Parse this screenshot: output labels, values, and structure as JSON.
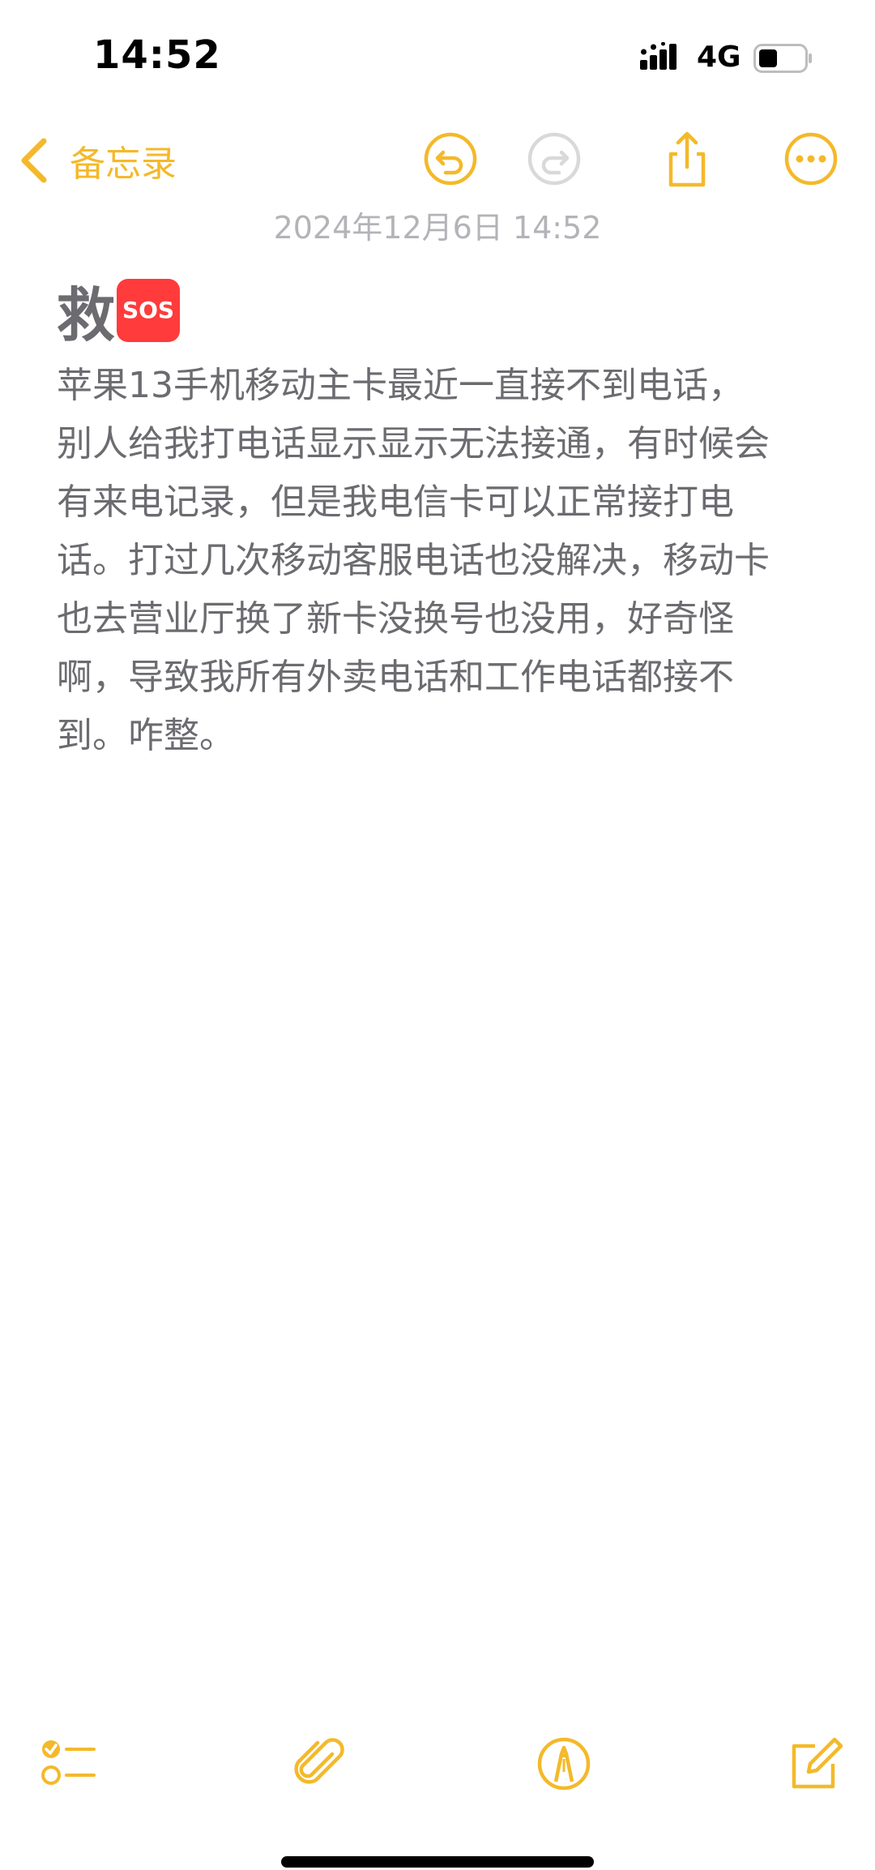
{
  "status_bar": {
    "time": "14:52",
    "network": "4G",
    "signal_icon": "cellular-signal-icon",
    "battery_icon": "battery-icon"
  },
  "nav": {
    "back_label": "备忘录",
    "back_icon": "chevron-left-icon",
    "undo_icon": "undo-icon",
    "redo_icon": "redo-icon",
    "share_icon": "share-icon",
    "more_icon": "more-icon",
    "accent_color": "#f4b92a",
    "disabled_color": "#d9d9d9"
  },
  "note": {
    "date": "2024年12月6日 14:52",
    "title": "救",
    "title_emoji": "SOS",
    "body": "苹果13手机移动主卡最近一直接不到电话，\n别人给我打电话显示显示无法接通，有时候会\n有来电记录，但是我电信卡可以正常接打电\n话。打过几次移动客服电话也没解决，移动卡\n也去营业厅换了新卡没换号也没用，好奇怪\n啊，导致我所有外卖电话和工作电话都接不\n到。咋整。"
  },
  "toolbar": {
    "checklist_icon": "checklist-icon",
    "attachment_icon": "paperclip-icon",
    "markup_icon": "markup-pen-icon",
    "compose_icon": "compose-icon"
  }
}
